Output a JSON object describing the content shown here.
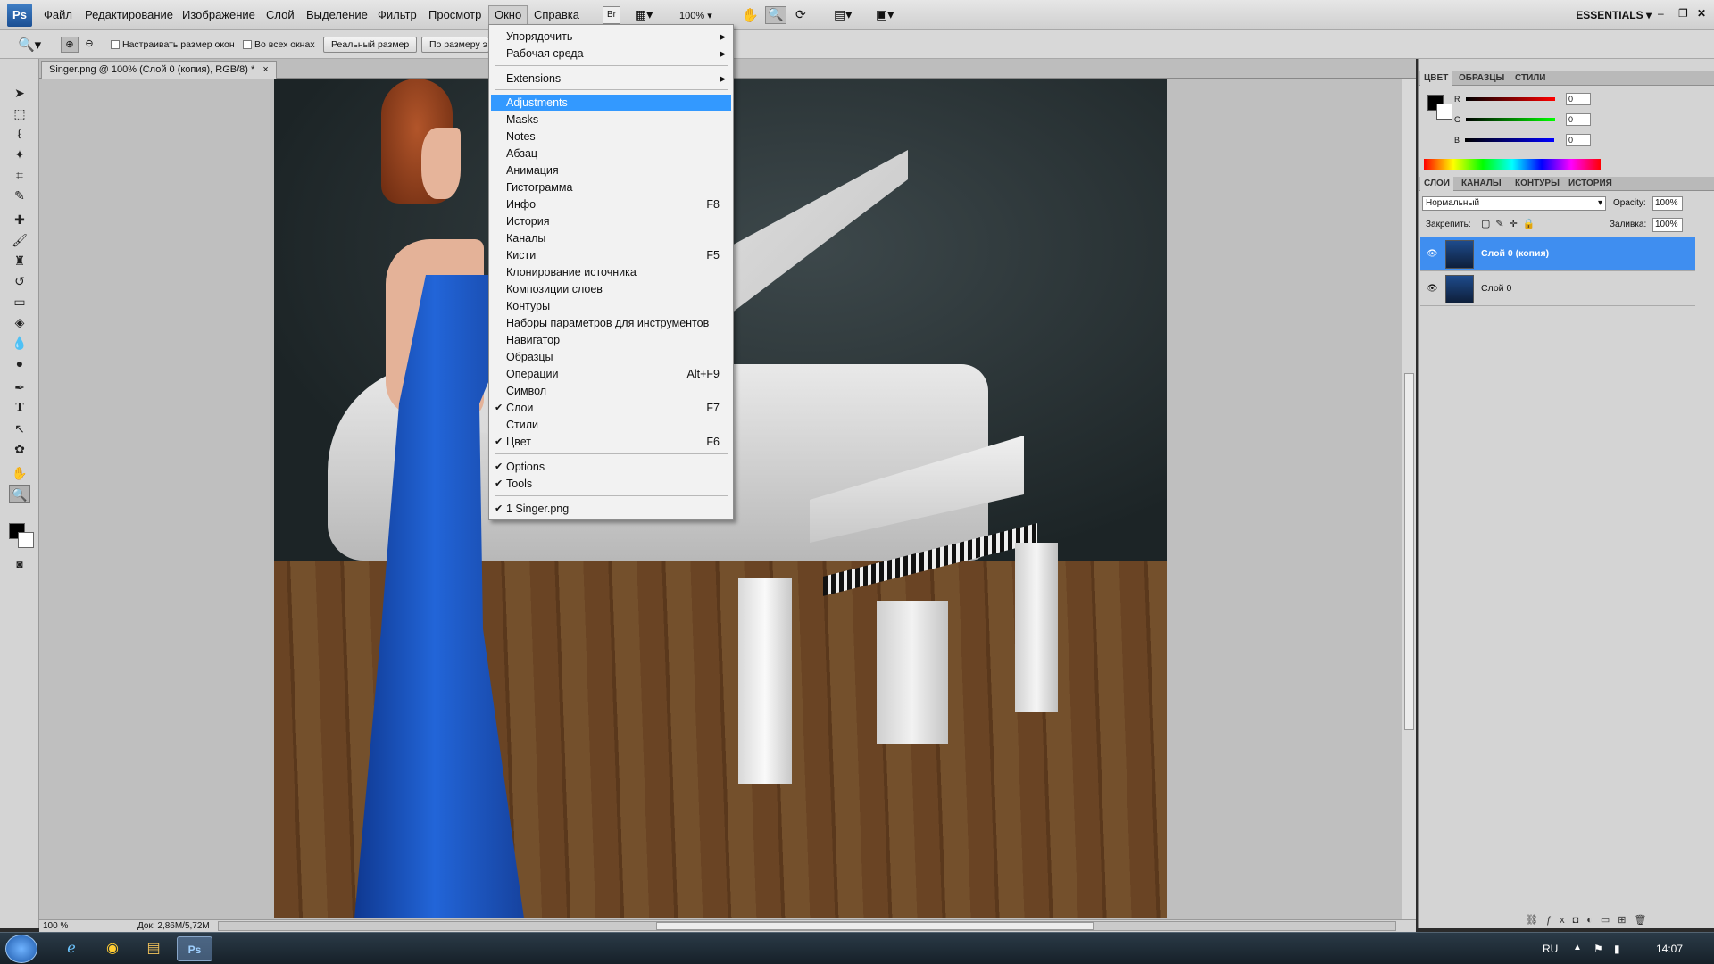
{
  "app": {
    "logo": "Ps",
    "workspace": "ESSENTIALS"
  },
  "menubar": {
    "items": [
      "Файл",
      "Редактирование",
      "Изображение",
      "Слой",
      "Выделение",
      "Фильтр",
      "Просмотр",
      "Окно",
      "Справка"
    ],
    "active": "Окно",
    "zoom": "100%",
    "br_label": "Br"
  },
  "options_bar": {
    "checkbox1": "Настраивать размер окон",
    "checkbox2": "Во всех окнах",
    "button1": "Реальный размер",
    "button2": "По размеру э"
  },
  "document": {
    "tab_title": "Singer.png @ 100% (Слой 0 (копия), RGB/8) *",
    "close": "×",
    "status_zoom": "100 %",
    "status_doc": "Док: 2,86M/5,72M"
  },
  "color_panel": {
    "tabs": [
      "ЦВЕТ",
      "ОБРАЗЦЫ",
      "СТИЛИ"
    ],
    "r_label": "R",
    "g_label": "G",
    "b_label": "B",
    "r": "0",
    "g": "0",
    "b": "0"
  },
  "layers_panel": {
    "tabs": [
      "СЛОИ",
      "КАНАЛЫ",
      "КОНТУРЫ",
      "ИСТОРИЯ"
    ],
    "blend_mode": "Нормальный",
    "opacity_label": "Opacity:",
    "opacity": "100%",
    "lock_label": "Закрепить:",
    "fill_label": "Заливка:",
    "fill": "100%",
    "layers": [
      {
        "name": "Слой 0 (копия)",
        "selected": true
      },
      {
        "name": "Слой 0",
        "selected": false
      }
    ]
  },
  "window_menu": {
    "items": [
      {
        "label": "Упорядочить",
        "submenu": true
      },
      {
        "label": "Рабочая среда",
        "submenu": true
      },
      {
        "label": "Extensions",
        "submenu": true
      },
      {
        "label": "Adjustments",
        "highlighted": true
      },
      {
        "label": "Masks"
      },
      {
        "label": "Notes"
      },
      {
        "label": "Абзац"
      },
      {
        "label": "Анимация"
      },
      {
        "label": "Гистограмма"
      },
      {
        "label": "Инфо",
        "shortcut": "F8"
      },
      {
        "label": "История"
      },
      {
        "label": "Каналы"
      },
      {
        "label": "Кисти",
        "shortcut": "F5"
      },
      {
        "label": "Клонирование источника"
      },
      {
        "label": "Композиции слоев"
      },
      {
        "label": "Контуры"
      },
      {
        "label": "Наборы параметров для инструментов"
      },
      {
        "label": "Навигатор"
      },
      {
        "label": "Образцы"
      },
      {
        "label": "Операции",
        "shortcut": "Alt+F9"
      },
      {
        "label": "Символ"
      },
      {
        "label": "Слои",
        "shortcut": "F7",
        "checked": true
      },
      {
        "label": "Стили"
      },
      {
        "label": "Цвет",
        "shortcut": "F6",
        "checked": true
      },
      {
        "label": "Options",
        "checked": true
      },
      {
        "label": "Tools",
        "checked": true
      },
      {
        "label": "1 Singer.png",
        "checked": true
      }
    ]
  },
  "taskbar": {
    "language": "RU",
    "time": "14:07"
  },
  "colors": {
    "highlight": "#3399ff",
    "layer_selected": "#3f8ef0",
    "dress": "#1f58c8"
  }
}
